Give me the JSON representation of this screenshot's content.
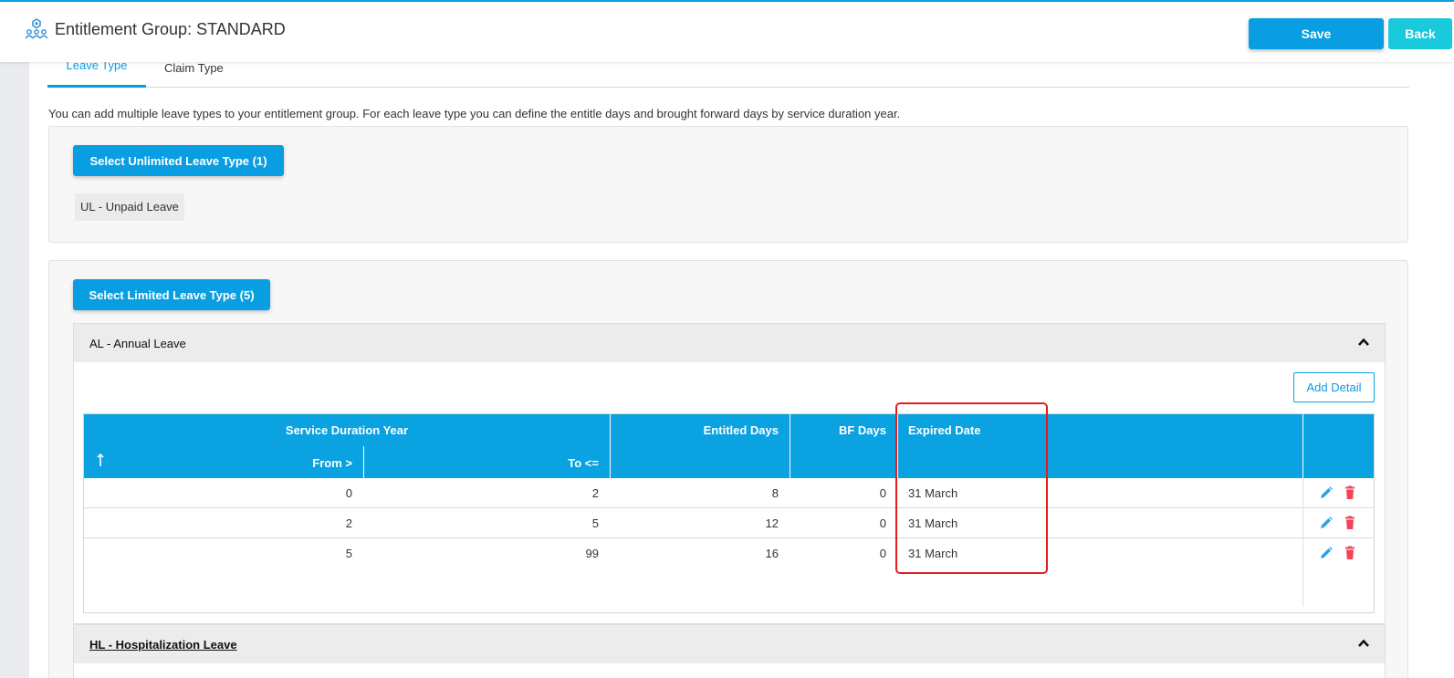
{
  "header": {
    "title": "Entitlement Group: STANDARD",
    "logo_icon": "people-network-icon",
    "save_label": "Save",
    "back_label": "Back"
  },
  "tabs": [
    {
      "label": "Leave Type",
      "active": true
    },
    {
      "label": "Claim Type",
      "active": false
    }
  ],
  "description": "You can add multiple leave types to your entitlement group. For each leave type you can define the entitle days and brought forward days by service duration year.",
  "unlimited": {
    "button_label": "Select Unlimited Leave Type (1)",
    "items": [
      "UL - Unpaid Leave"
    ]
  },
  "limited": {
    "button_label": "Select Limited Leave Type (5)",
    "sections": [
      {
        "title": "AL - Annual Leave",
        "expanded": true,
        "add_label": "Add Detail",
        "table": {
          "group_header": "Service Duration Year",
          "sort_icon": "arrow-up-icon",
          "columns": {
            "from": "From >",
            "to": "To <=",
            "entitled": "Entitled Days",
            "bf": "BF Days",
            "expired": "Expired Date"
          },
          "rows": [
            {
              "from": "0",
              "to": "2",
              "entitled": "8",
              "bf": "0",
              "expired": "31 March"
            },
            {
              "from": "2",
              "to": "5",
              "entitled": "12",
              "bf": "0",
              "expired": "31 March"
            },
            {
              "from": "5",
              "to": "99",
              "entitled": "16",
              "bf": "0",
              "expired": "31 March"
            }
          ],
          "row_actions": [
            "pencil-icon",
            "trash-icon"
          ]
        }
      },
      {
        "title": "HL - Hospitalization Leave",
        "expanded": true
      }
    ]
  },
  "colors": {
    "primary": "#089ee1",
    "secondary": "#19c9dc",
    "delete": "#f0445a",
    "highlight": "#e31d1d"
  }
}
